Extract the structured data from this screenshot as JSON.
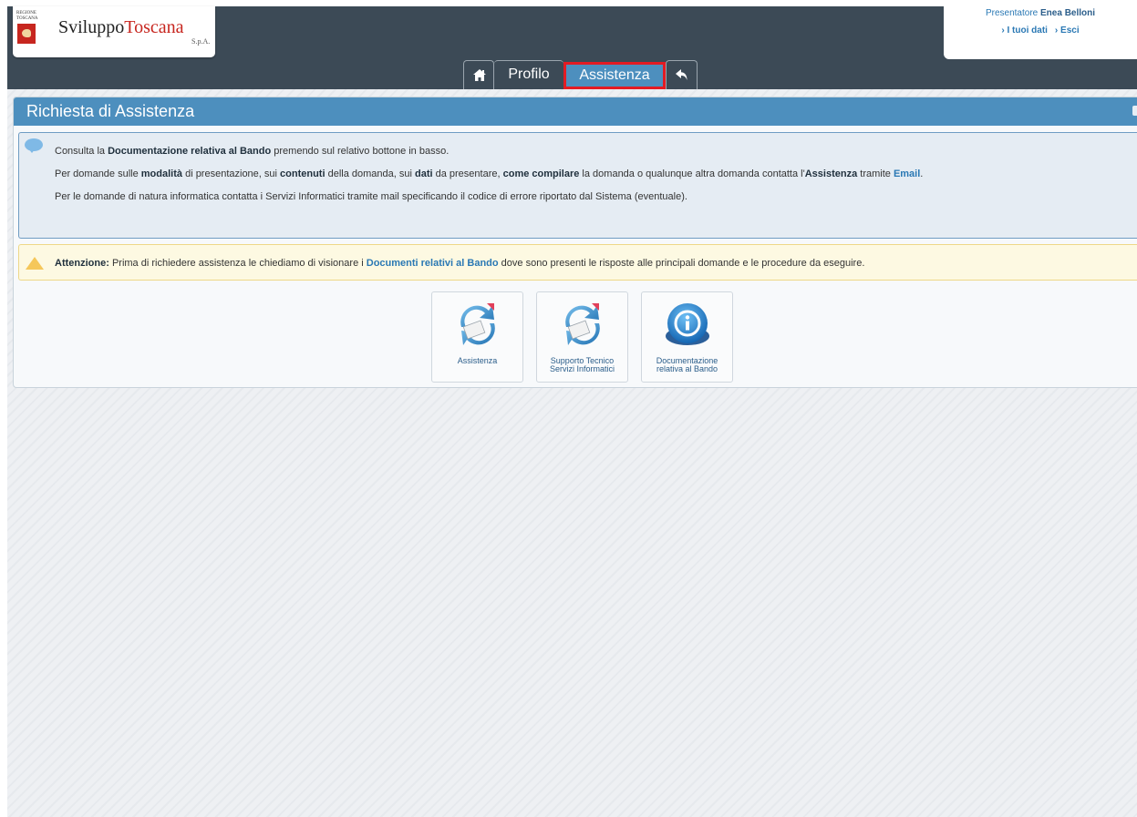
{
  "header": {
    "logo_region": "REGIONE TOSCANA",
    "logo_sviluppo": "Sviluppo",
    "logo_toscana": "Toscana",
    "logo_spa": "S.p.A.",
    "user_prefix": "Presentatore",
    "user_name": "Enea Belloni",
    "link_dati": "› I tuoi dati",
    "link_esci": "› Esci"
  },
  "tabs": {
    "home_icon": "home-icon",
    "profilo": "Profilo",
    "assistenza": "Assistenza",
    "back_icon": "back-arrow-icon"
  },
  "panel": {
    "title": "Richiesta di Assistenza",
    "info": {
      "l1_a": "Consulta la ",
      "l1_b": "Documentazione relativa al Bando",
      "l1_c": " premendo sul relativo bottone in basso.",
      "l2_a": "Per domande sulle ",
      "l2_b": "modalità",
      "l2_c": " di presentazione, sui ",
      "l2_d": "contenuti",
      "l2_e": " della domanda, sui ",
      "l2_f": "dati",
      "l2_g": " da presentare, ",
      "l2_h": "come compilare",
      "l2_i": " la domanda o qualunque altra domanda contatta l'",
      "l2_j": "Assistenza",
      "l2_k": " tramite ",
      "l2_l": "Email",
      "l2_m": ".",
      "l3": "Per le domande di natura informatica contatta i Servizi Informatici tramite mail specificando il codice di errore riportato dal Sistema (eventuale)."
    },
    "warning": {
      "label": "Attenzione:",
      "a": " Prima di richiedere assistenza le chiediamo di visionare i ",
      "link": "Documenti relativi al Bando",
      "b": " dove sono presenti le risposte alle principali domande e le procedure da eseguire."
    },
    "buttons": [
      {
        "line1": "Assistenza",
        "line2": "",
        "icon": "email-sync-icon"
      },
      {
        "line1": "Supporto Tecnico",
        "line2": "Servizi Informatici",
        "icon": "email-sync-icon"
      },
      {
        "line1": "Documentazione",
        "line2": "relativa al Bando",
        "icon": "info-icon"
      }
    ]
  },
  "colors": {
    "topbar": "#3c4a56",
    "accent": "#4d8fbe",
    "highlight_border": "#e31b23",
    "link": "#2a78b4",
    "warning_bg": "#fdf9e2"
  }
}
